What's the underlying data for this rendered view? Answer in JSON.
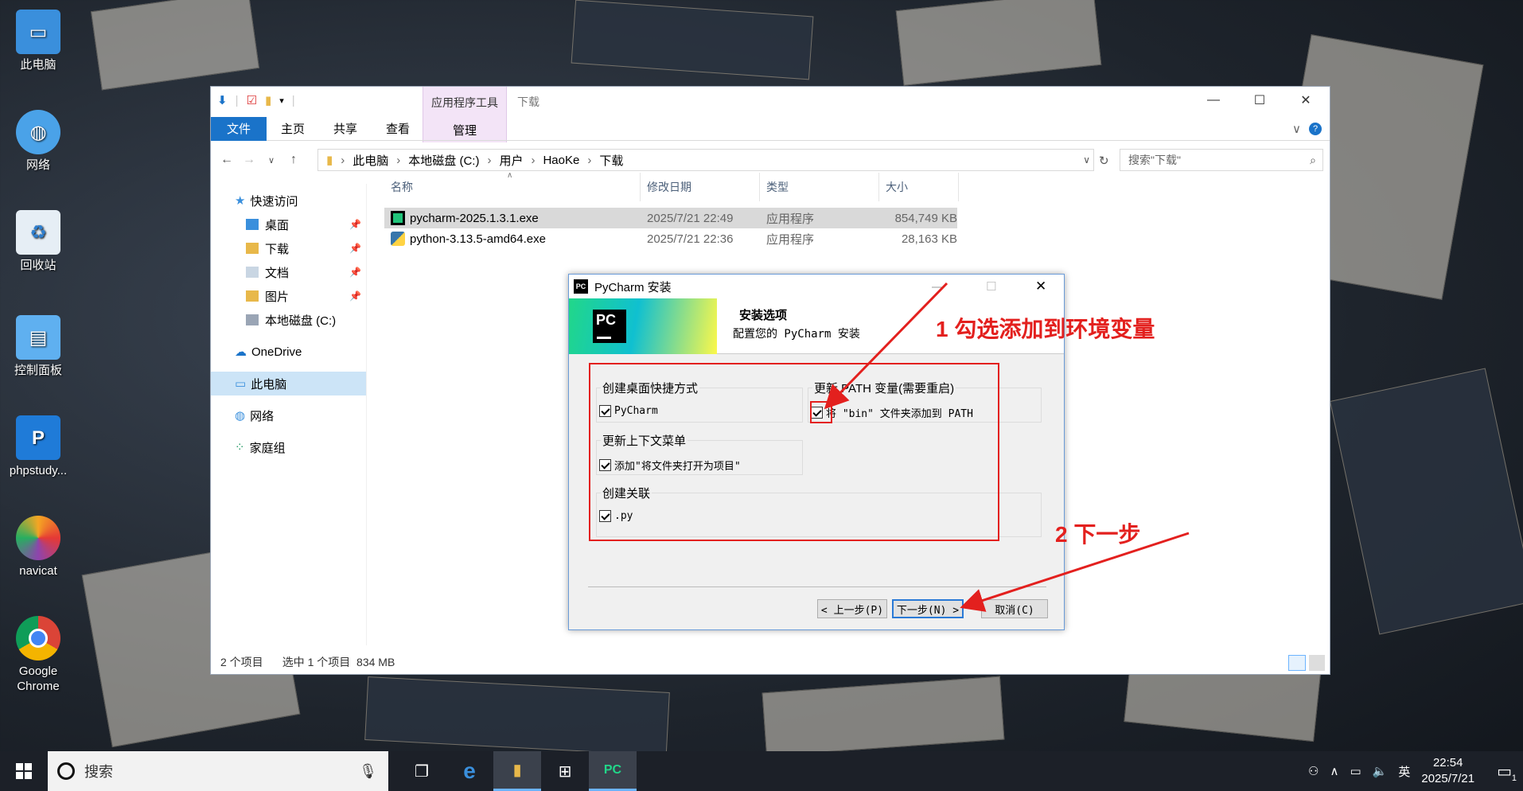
{
  "desktop": {
    "icons": [
      {
        "label": "此电脑",
        "icon": "computer-icon"
      },
      {
        "label": "网络",
        "icon": "network-globe-icon"
      },
      {
        "label": "回收站",
        "icon": "recycle-bin-icon"
      },
      {
        "label": "控制面板",
        "icon": "control-panel-icon"
      },
      {
        "label": "phpstudy...",
        "icon": "phpstudy-icon"
      },
      {
        "label": "navicat",
        "icon": "navicat-icon"
      },
      {
        "label": "Google Chrome",
        "icon": "chrome-icon"
      }
    ]
  },
  "explorer": {
    "context_tab_group": "应用程序工具",
    "context_tab": "管理",
    "window_title": "下载",
    "ribbon_tabs": [
      "文件",
      "主页",
      "共享",
      "查看"
    ],
    "breadcrumb": [
      "此电脑",
      "本地磁盘 (C:)",
      "用户",
      "HaoKe",
      "下载"
    ],
    "search_placeholder": "搜索\"下载\"",
    "nav": {
      "quick_access": "快速访问",
      "items": [
        {
          "label": "桌面",
          "pinned": true
        },
        {
          "label": "下载",
          "pinned": true
        },
        {
          "label": "文档",
          "pinned": true
        },
        {
          "label": "图片",
          "pinned": true
        },
        {
          "label": "本地磁盘 (C:)",
          "pinned": false
        }
      ],
      "onedrive": "OneDrive",
      "this_pc": "此电脑",
      "network": "网络",
      "homegroup": "家庭组"
    },
    "columns": [
      "名称",
      "修改日期",
      "类型",
      "大小"
    ],
    "files": [
      {
        "name": "pycharm-2025.1.3.1.exe",
        "date": "2025/7/21 22:49",
        "type": "应用程序",
        "size": "854,749 KB",
        "selected": true
      },
      {
        "name": "python-3.13.5-amd64.exe",
        "date": "2025/7/21 22:36",
        "type": "应用程序",
        "size": "28,163 KB",
        "selected": false
      }
    ],
    "status": {
      "count": "2 个项目",
      "selection": "选中 1 个项目",
      "size": "834 MB"
    }
  },
  "installer": {
    "title": "PyCharm 安装",
    "header_title": "安装选项",
    "header_subtitle": "配置您的 PyCharm 安装",
    "groups": {
      "shortcut": {
        "label": "创建桌面快捷方式",
        "option": "PyCharm",
        "checked": true
      },
      "path": {
        "label": "更新 PATH 变量(需要重启)",
        "option": "将 \"bin\" 文件夹添加到 PATH",
        "checked": true
      },
      "context": {
        "label": "更新上下文菜单",
        "option": "添加\"将文件夹打开为项目\"",
        "checked": true
      },
      "assoc": {
        "label": "创建关联",
        "option": ".py",
        "checked": true
      }
    },
    "buttons": {
      "back": "< 上一步(P)",
      "next": "下一步(N) >",
      "cancel": "取消(C)"
    }
  },
  "annotations": {
    "step1": "1 勾选添加到环境变量",
    "step2": "2 下一步"
  },
  "taskbar": {
    "search_placeholder": "搜索",
    "time": "22:54",
    "date": "2025/7/21",
    "ime": "英",
    "notification_count": "1"
  }
}
